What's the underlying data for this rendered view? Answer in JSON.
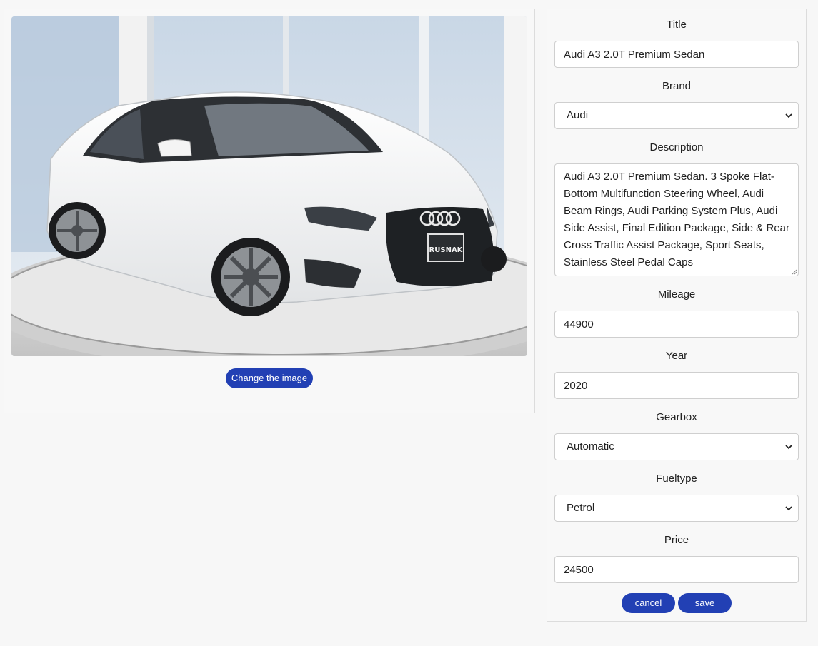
{
  "image_panel": {
    "change_label": "Change the image",
    "plate_text": "RUSNAK"
  },
  "form": {
    "title": {
      "label": "Title",
      "value": "Audi A3 2.0T Premium Sedan"
    },
    "brand": {
      "label": "Brand",
      "value": "Audi"
    },
    "description": {
      "label": "Description",
      "value": "Audi A3 2.0T Premium Sedan. 3 Spoke Flat-Bottom Multifunction Steering Wheel, Audi Beam Rings, Audi Parking System Plus, Audi Side Assist, Final Edition Package, Side & Rear Cross Traffic Assist Package, Sport Seats, Stainless Steel Pedal Caps"
    },
    "mileage": {
      "label": "Mileage",
      "value": "44900"
    },
    "year": {
      "label": "Year",
      "value": "2020"
    },
    "gearbox": {
      "label": "Gearbox",
      "value": "Automatic"
    },
    "fueltype": {
      "label": "Fueltype",
      "value": "Petrol"
    },
    "price": {
      "label": "Price",
      "value": "24500"
    }
  },
  "actions": {
    "cancel_label": "cancel",
    "save_label": "save"
  },
  "colors": {
    "accent": "#2240b4",
    "page_background": "#f7f7f7",
    "card_border": "#dcdcdc"
  },
  "icons": {
    "select_arrow": "chevron-down-icon"
  }
}
